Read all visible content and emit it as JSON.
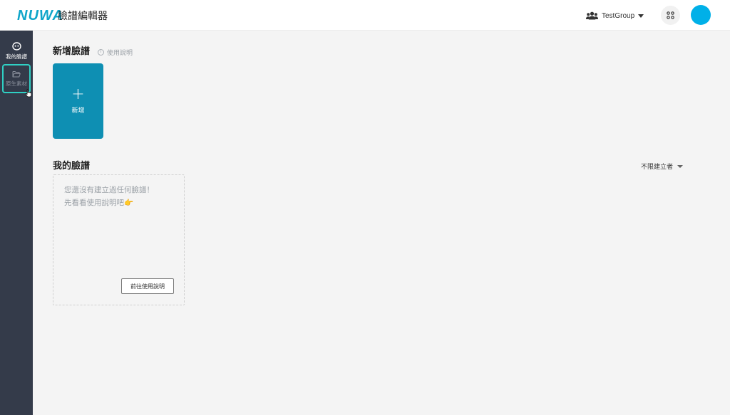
{
  "header": {
    "logo_text": "NUWA",
    "app_title": "臉譜編輯器",
    "group_icon": "users-icon",
    "group_name": "TestGroup",
    "apps_icon": "grid-dots-icon",
    "avatar_color": "#00b0e8"
  },
  "sidebar": {
    "items": [
      {
        "label": "我的臉譜",
        "icon": "face-icon",
        "active": true
      },
      {
        "label": "原生素材",
        "icon": "folder-open-icon",
        "active": false,
        "hovered": true
      }
    ]
  },
  "create_section": {
    "title": "新增臉譜",
    "help_link": "使用說明",
    "new_card_label": "新增",
    "new_card_color": "#0e8fb3"
  },
  "my_faces": {
    "title": "我的臉譜",
    "filter_label": "不限建立者",
    "empty_line1": "您還沒有建立過任何臉譜！",
    "empty_line2": "先看看使用說明吧👉",
    "guide_button": "前往使用說明"
  },
  "colors": {
    "accent": "#0ea5c9",
    "sidebar_bg": "#343b4a",
    "highlight": "#2fd0c4"
  }
}
